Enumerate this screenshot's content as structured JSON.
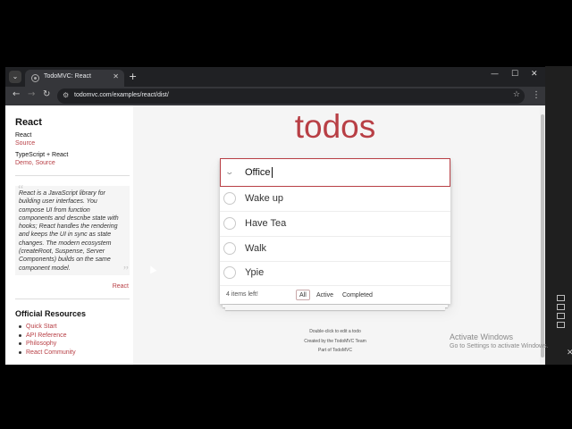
{
  "browser": {
    "tab_title": "TodoMVC: React",
    "url": "todomvc.com/examples/react/dist/",
    "icons": [
      "tab-search-icon",
      "favicon-icon",
      "close-icon",
      "plus-icon",
      "minimize-icon",
      "maximize-icon",
      "back-icon",
      "forward-icon",
      "reload-icon",
      "site-info-icon",
      "star-icon",
      "kebab-menu-icon"
    ]
  },
  "sidebar": {
    "title": "React",
    "framework_label": "React",
    "source_link": "Source",
    "ts_label": "TypeScript + React",
    "demo_link": "Demo",
    "sep": ", ",
    "source_link2": "Source",
    "quote_lines": [
      "React is a JavaScript library for",
      "building user interfaces. You",
      "compose UI from function",
      "components and describe state with",
      "hooks; React handles the rendering",
      "and keeps the UI in sync as state",
      "changes. The modern ecosystem",
      "(createRoot, Suspense, Server",
      "Components) builds on the same",
      "component model."
    ],
    "quote_source": "React",
    "resources_title": "Official Resources",
    "resources": [
      "Quick Start",
      "API Reference",
      "Philosophy",
      "React Community"
    ]
  },
  "app": {
    "title": "todos",
    "input_value": "Office",
    "todos": [
      {
        "label": "Wake up"
      },
      {
        "label": "Have Tea"
      },
      {
        "label": "Walk"
      },
      {
        "label": "Ypie"
      }
    ],
    "count_text": "4 items left!",
    "filters": [
      {
        "label": "All",
        "selected": true
      },
      {
        "label": "Active",
        "selected": false
      },
      {
        "label": "Completed",
        "selected": false
      }
    ],
    "info": [
      "Double-click to edit a todo",
      "Created by the TodoMVC Team",
      "Part of TodoMVC"
    ]
  },
  "windows": {
    "activate_title": "Activate Windows",
    "activate_sub": "Go to Settings to activate Windows."
  },
  "colors": {
    "accent": "#b83f45",
    "page_bg": "#f5f5f5"
  }
}
